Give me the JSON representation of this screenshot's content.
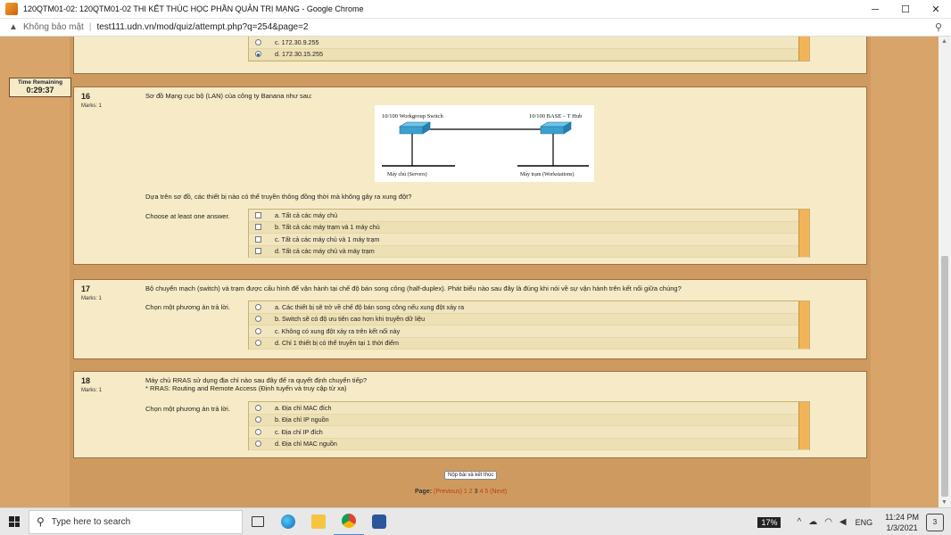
{
  "window": {
    "title": "120QTM01-02: 120QTM01-02 THI KẾT THÚC HỌC PHẦN QUẢN TRỊ MẠNG - Google Chrome",
    "minimize": "─",
    "maximize": "☐",
    "close": "✕"
  },
  "address": {
    "security_label": "Không bảo mật",
    "separator": "|",
    "url": "test111.udn.vn/mod/quiz/attempt.php?q=254&page=2"
  },
  "timer": {
    "label": "Time Remaining",
    "value": "0:29:37"
  },
  "prev_question": {
    "answers": [
      {
        "text": "c. 172.30.9.255",
        "checked": false
      },
      {
        "text": "d. 172.30.15.255",
        "checked": true
      }
    ]
  },
  "questions": [
    {
      "number": "16",
      "marks": "Marks: 1",
      "text": "Sơ đồ Mạng cục bộ (LAN) của công ty Banana như sau:",
      "diagram": {
        "switch_label": "10/100 Workgroup Switch",
        "hub_label": "10/100 BASE – T Hub",
        "servers_label": "Máy chủ (Servers)",
        "workstations_label": "Máy trạm (Workstations)"
      },
      "prompt": "Dựa trên sơ đồ, các thiết bị nào có thể truyền thông đồng thời mà không gây ra xung đột?",
      "instruction": "Choose at least one answer.",
      "answers": [
        "a. Tất cả các máy chủ",
        "b. Tất cả các máy trạm và 1 máy chủ",
        "c. Tất cả các máy chủ và 1 máy trạm",
        "d. Tất cả các máy chủ và máy trạm"
      ]
    },
    {
      "number": "17",
      "marks": "Marks: 1",
      "text": "Bộ chuyển mạch (switch) và trạm được cấu hình để vận hành tại chế độ bán song công (half-duplex). Phát biểu nào sau đây là đúng khi nói về sự vận hành trên kết nối giữa chúng?",
      "instruction": "Chọn một phương án trả lời.",
      "answers": [
        "a. Các thiết bị sẽ trở về chế độ bán song công nếu xung đột xảy ra",
        "b. Switch sẽ có độ ưu tiên cao hơn khi truyền dữ liệu",
        "c. Không có xung đột xảy ra trên kết nối này",
        "d. Chỉ 1 thiết bị có thể truyền tại 1 thời điểm"
      ]
    },
    {
      "number": "18",
      "marks": "Marks: 1",
      "text": "Máy chủ RRAS sử dụng địa chỉ nào sau đây để ra quyết định chuyển tiếp?",
      "text2": "* RRAS: Routing and Remote Access (Định tuyến và truy cập từ xa)",
      "instruction": "Chọn một phương án trả lời.",
      "answers": [
        "a. Địa chỉ MAC đích",
        "b. Địa chỉ IP nguồn",
        "c. Địa chỉ IP đích",
        "d. Địa chỉ MAC nguồn"
      ]
    }
  ],
  "footer": {
    "submit_label": "Nộp bài và kết thúc",
    "page_label": "Page:",
    "prev": "(Previous)",
    "pages": [
      "1",
      "2",
      "3",
      "4",
      "5"
    ],
    "current_page": "3",
    "next": "(Next)"
  },
  "taskbar": {
    "search_placeholder": "Type here to search",
    "battery": "17%",
    "language": "ENG",
    "time": "11:24 PM",
    "date": "1/3/2021",
    "notifications": "3"
  }
}
